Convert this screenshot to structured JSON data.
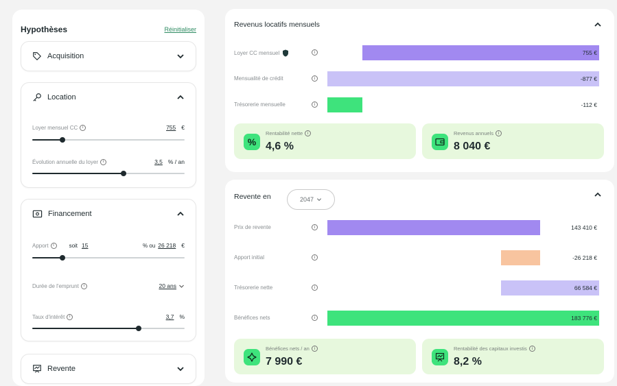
{
  "left": {
    "title": "Hypothèses",
    "reset": "Réinitialiser",
    "acquisition": {
      "label": "Acquisition"
    },
    "location": {
      "label": "Location",
      "rent_label": "Loyer mensuel CC",
      "rent_value": "755",
      "rent_unit": "€",
      "rent_slider": 0.2,
      "growth_label": "Évolution annuelle du loyer",
      "growth_value": "3,5",
      "growth_unit": "% / an",
      "growth_slider": 0.6
    },
    "financement": {
      "label": "Financement",
      "apport_label": "Apport",
      "apport_soit": "soit",
      "apport_pct": "15",
      "apport_ou": "% ou",
      "apport_amount": "26 218",
      "apport_unit": "€",
      "apport_slider": 0.2,
      "duree_label": "Durée de l'emprunt",
      "duree_value": "20 ans",
      "taux_label": "Taux d'intérêt",
      "taux_value": "3,7",
      "taux_unit": "%",
      "taux_slider": 0.7
    },
    "revente": {
      "label": "Revente"
    }
  },
  "revenus": {
    "title": "Revenus locatifs mensuels",
    "rows": [
      {
        "label": "Loyer CC mensuel",
        "value": "755 €",
        "color": "#a189f0"
      },
      {
        "label": "Mensualité de crédit",
        "value": "-877 €",
        "color": "#c9c2f7"
      },
      {
        "label": "Trésorerie mensuelle",
        "value": "-112 €",
        "color": "#3ee37c"
      }
    ],
    "kpis": [
      {
        "label": "Rentabilité nette",
        "value": "4,6 %",
        "icon": "percent-icon"
      },
      {
        "label": "Revenus annuels",
        "value": "8 040 €",
        "icon": "wallet-icon"
      }
    ]
  },
  "revente": {
    "title": "Revente en",
    "year": "2047",
    "rows": [
      {
        "label": "Prix de revente",
        "value": "143 410 €",
        "color": "#a189f0"
      },
      {
        "label": "Apport initial",
        "value": "-26 218 €",
        "color": "#f8c49f"
      },
      {
        "label": "Trésorerie nette",
        "value": "66 584 €",
        "color": "#c9c2f7"
      },
      {
        "label": "Bénéfices nets",
        "value": "183 776 €",
        "color": "#3ee37c"
      }
    ],
    "kpis": [
      {
        "label": "Bénéfices nets / an",
        "value": "7 990 €",
        "icon": "sparkle-icon"
      },
      {
        "label": "Rentabilité des capitaux investis",
        "value": "8,2 %",
        "icon": "presentation-chart-icon"
      }
    ]
  }
}
